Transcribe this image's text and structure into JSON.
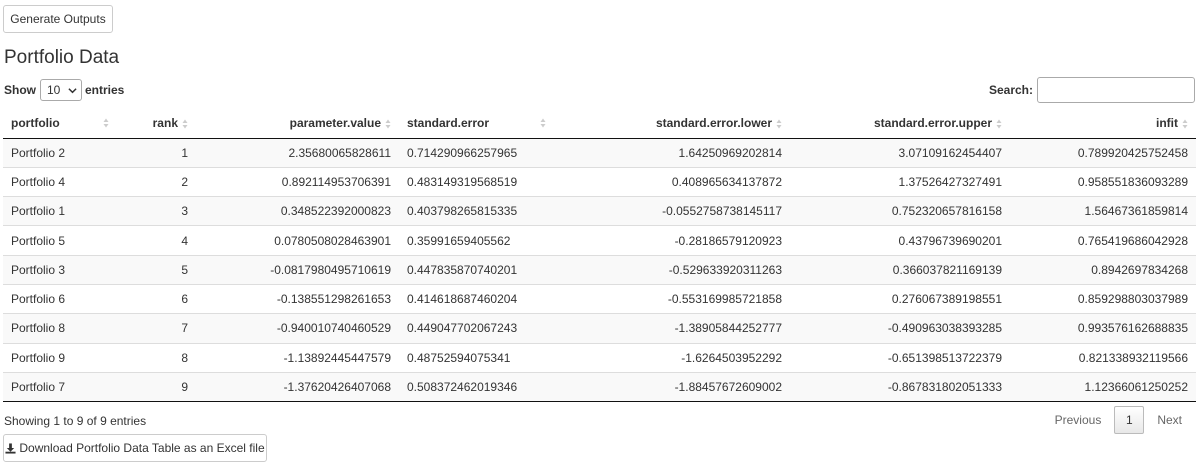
{
  "toolbar": {
    "generate_label": "Generate Outputs"
  },
  "page": {
    "title": "Portfolio Data"
  },
  "length_menu": {
    "show": "Show",
    "value": "10",
    "entries": "entries"
  },
  "filter": {
    "label": "Search:",
    "value": ""
  },
  "table": {
    "headers": [
      "portfolio",
      "rank",
      "parameter.value",
      "standard.error",
      "standard.error.lower",
      "standard.error.upper",
      "infit"
    ],
    "rows": [
      [
        "Portfolio 2",
        "1",
        "2.35680065828611",
        "0.714290966257965",
        "1.64250969202814",
        "3.07109162454407",
        "0.789920425752458"
      ],
      [
        "Portfolio 4",
        "2",
        "0.892114953706391",
        "0.483149319568519",
        "0.408965634137872",
        "1.37526427327491",
        "0.958551836093289"
      ],
      [
        "Portfolio 1",
        "3",
        "0.348522392000823",
        "0.403798265815335",
        "-0.0552758738145117",
        "0.752320657816158",
        "1.5646736185981 4"
      ],
      [
        "Portfolio 5",
        "4",
        "0.0780508028463901",
        "0.35991659405562",
        "-0.28186579120923",
        "0.43796739690201",
        "0.765419686042928"
      ],
      [
        "Portfolio 3",
        "5",
        "-0.0817980495710619",
        "0.447835870740201",
        "-0.529633920311263",
        "0.366037821169139",
        "0.8942697834268"
      ],
      [
        "Portfolio 6",
        "6",
        "-0.138551298261653",
        "0.414618687460204",
        "-0.553169985721858",
        "0.276067389198551",
        "0.859298803037989"
      ],
      [
        "Portfolio 8",
        "7",
        "-0.940010740460529",
        "0.449047702067243",
        "-1.38905844252777",
        "-0.490963038393285",
        "0.993576162688835"
      ],
      [
        "Portfolio 9",
        "8",
        "-1.13892445447579",
        "0.48752594075341",
        "-1.6264503952292",
        "-0.651398513722379",
        "0.821338932119566"
      ],
      [
        "Portfolio 7",
        "9",
        "-1.37620426407068",
        "0.508372462019346",
        "-1.88457672609002",
        "-0.867831802051333",
        "1.12366061250252"
      ]
    ]
  },
  "info": "Showing 1 to 9 of 9 entries",
  "pagination": {
    "previous": "Previous",
    "current": "1",
    "next": "Next"
  },
  "download": {
    "label": "Download Portfolio Data Table as an Excel file",
    "icon": "download-icon"
  }
}
